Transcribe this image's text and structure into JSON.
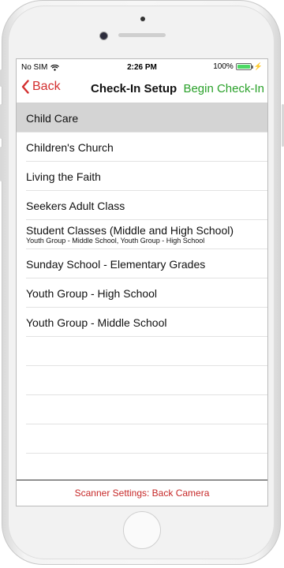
{
  "status": {
    "carrier": "No SIM",
    "time": "2:26 PM",
    "battery_percent": "100%",
    "battery_level": 1.0,
    "wifi_icon": "wifi-icon",
    "charging_icon": "charging-bolt-icon"
  },
  "nav": {
    "back_label": "Back",
    "title": "Check-In Setup",
    "begin_label": "Begin Check-In",
    "back_color": "#d32f2f",
    "begin_color": "#2aa12a"
  },
  "items": [
    {
      "title": "Child Care",
      "subtitle": "",
      "selected": true
    },
    {
      "title": "Children's Church",
      "subtitle": ""
    },
    {
      "title": "Living the Faith",
      "subtitle": ""
    },
    {
      "title": "Seekers Adult Class",
      "subtitle": ""
    },
    {
      "title": "Student Classes (Middle and High School)",
      "subtitle": "Youth Group - Middle School, Youth Group - High School"
    },
    {
      "title": "Sunday School - Elementary Grades",
      "subtitle": ""
    },
    {
      "title": "Youth Group - High School",
      "subtitle": ""
    },
    {
      "title": "Youth Group - Middle School",
      "subtitle": ""
    }
  ],
  "footer": {
    "scanner_label": "Scanner Settings: Back Camera",
    "color": "#c62828"
  }
}
